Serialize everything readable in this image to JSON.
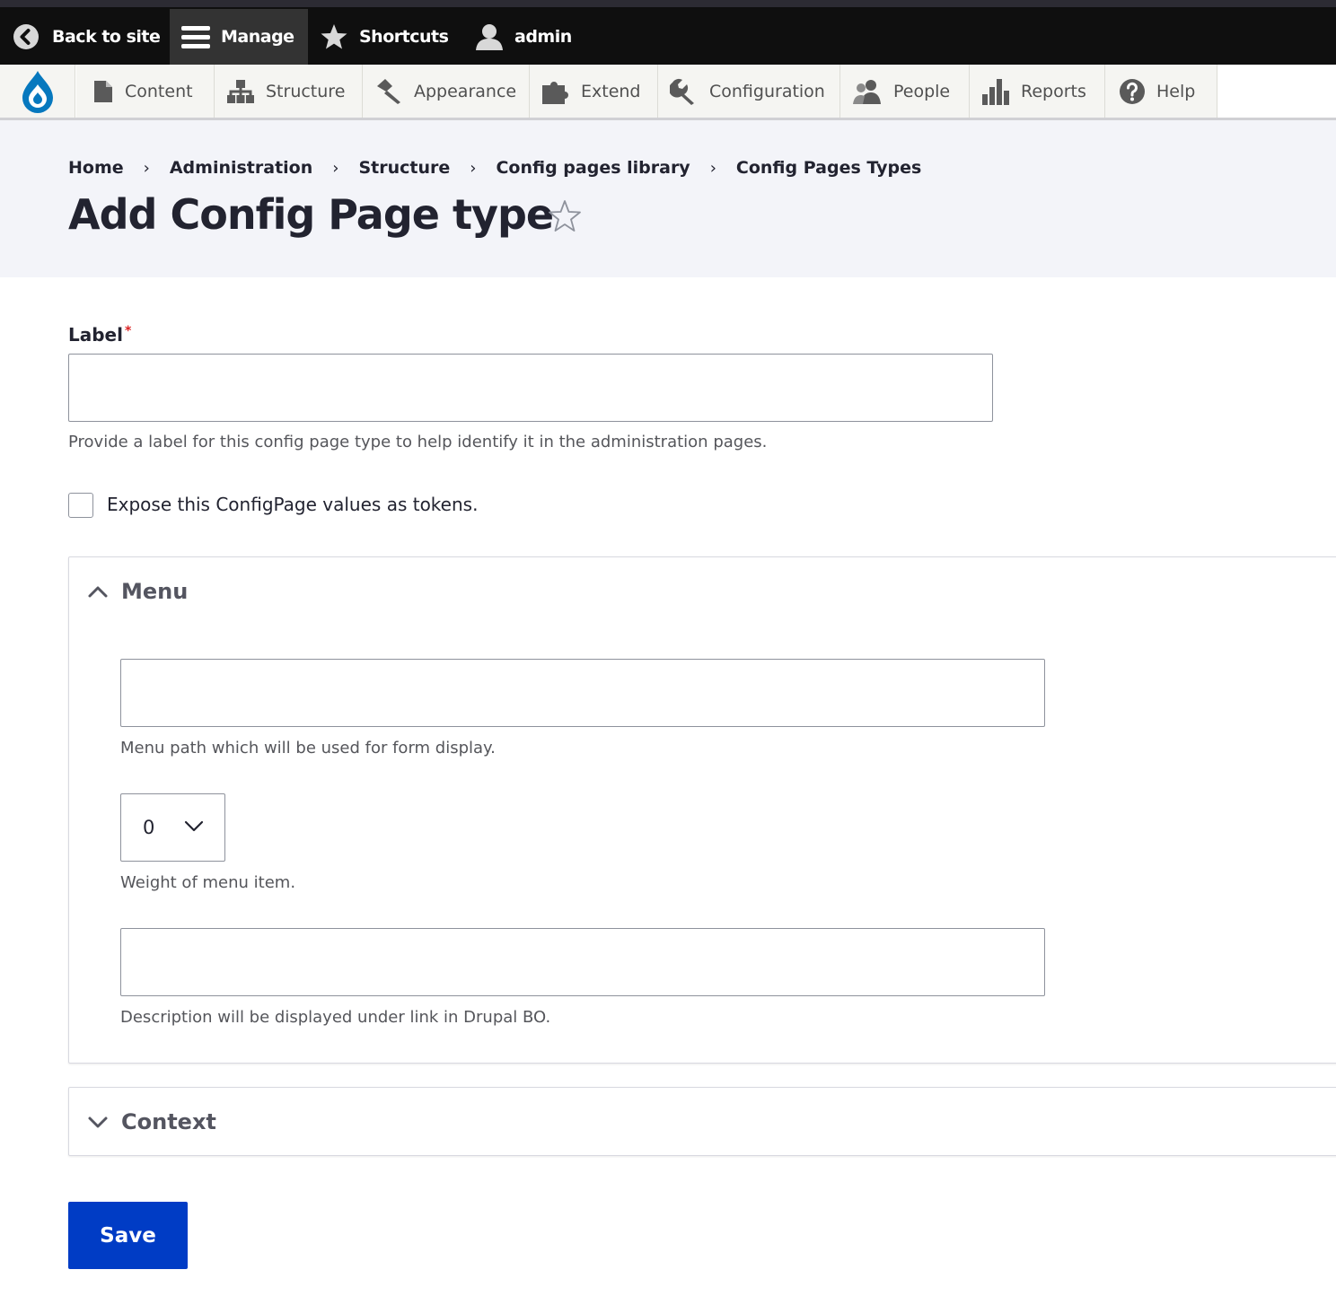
{
  "toolbar": {
    "back_to_site": "Back to site",
    "manage": "Manage",
    "shortcuts": "Shortcuts",
    "user": "admin"
  },
  "tray": {
    "items": [
      {
        "label": "Content",
        "icon": "content-icon"
      },
      {
        "label": "Structure",
        "icon": "structure-icon"
      },
      {
        "label": "Appearance",
        "icon": "appearance-icon"
      },
      {
        "label": "Extend",
        "icon": "extend-icon"
      },
      {
        "label": "Configuration",
        "icon": "configuration-icon"
      },
      {
        "label": "People",
        "icon": "people-icon"
      },
      {
        "label": "Reports",
        "icon": "reports-icon"
      },
      {
        "label": "Help",
        "icon": "help-icon"
      }
    ]
  },
  "breadcrumb": [
    "Home",
    "Administration",
    "Structure",
    "Config pages library",
    "Config Pages Types"
  ],
  "page": {
    "title": "Add Config Page type"
  },
  "form": {
    "label_field": {
      "label": "Label",
      "required_marker": "*",
      "value": "",
      "description": "Provide a label for this config page type to help identify it in the administration pages."
    },
    "tokens_checkbox": {
      "label": "Expose this ConfigPage values as tokens.",
      "checked": false
    },
    "menu": {
      "title": "Menu",
      "expanded": true,
      "path_value": "",
      "path_description": "Menu path which will be used for form display.",
      "weight_value": "0",
      "weight_description": "Weight of menu item.",
      "desc_value": "",
      "desc_description": "Description will be displayed under link in Drupal BO."
    },
    "context": {
      "title": "Context",
      "expanded": false
    },
    "save_label": "Save"
  },
  "colors": {
    "primary_button": "#003cc5",
    "toolbar_bg": "#0f0f0f",
    "drupal_blue": "#0678be",
    "required": "#dc2323"
  }
}
